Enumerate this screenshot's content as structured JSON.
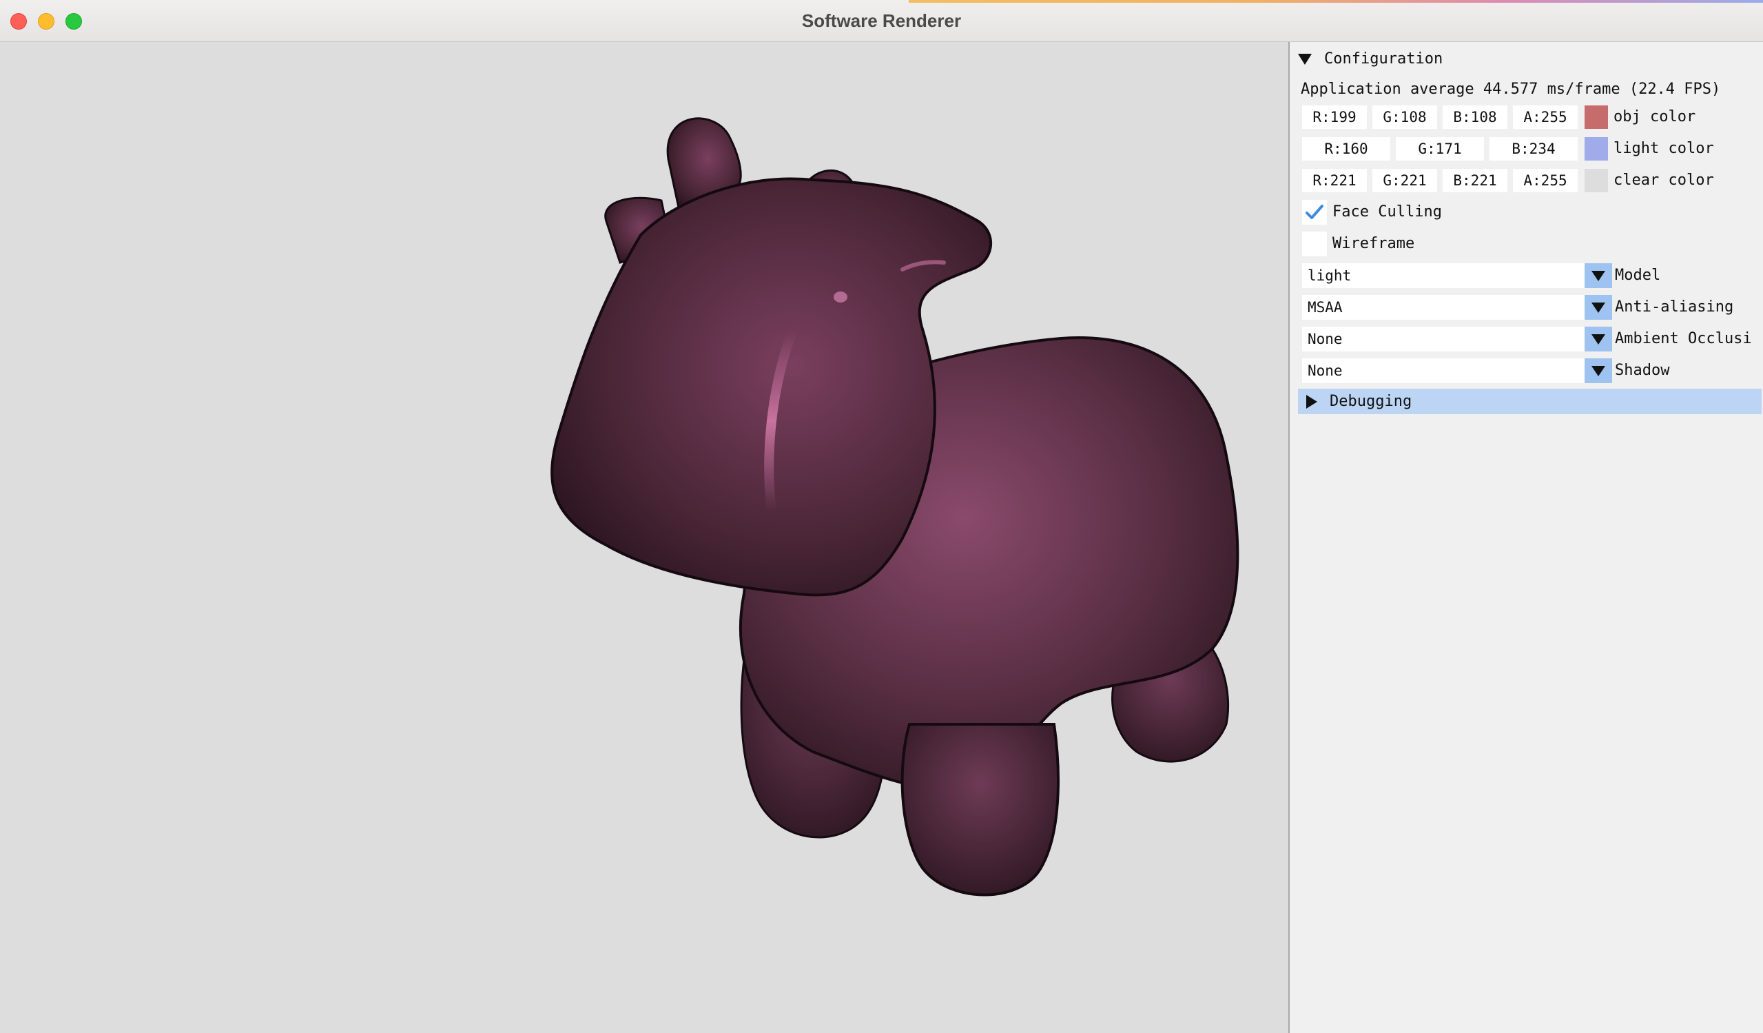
{
  "window": {
    "title": "Software Renderer"
  },
  "panel": {
    "header": "Configuration",
    "fps_text": "Application average 44.577 ms/frame (22.4 FPS)",
    "obj_color": {
      "r": "R:199",
      "g": "G:108",
      "b": "B:108",
      "a": "A:255",
      "label": "obj color",
      "swatch": "#c76c6c"
    },
    "light_color": {
      "r": "R:160",
      "g": "G:171",
      "b": "B:234",
      "label": "light color",
      "swatch": "#a0abea"
    },
    "clear_color": {
      "r": "R:221",
      "g": "G:221",
      "b": "B:221",
      "a": "A:255",
      "label": "clear color",
      "swatch": "#dddddd"
    },
    "face_culling": {
      "label": "Face Culling",
      "checked": true
    },
    "wireframe": {
      "label": "Wireframe",
      "checked": false
    },
    "model": {
      "value": "light",
      "label": "Model"
    },
    "anti_aliasing": {
      "value": "MSAA",
      "label": "Anti-aliasing"
    },
    "ambient_occlusion": {
      "value": "None",
      "label": "Ambient Occlusi"
    },
    "shadow": {
      "value": "None",
      "label": "Shadow"
    },
    "debugging": {
      "label": "Debugging"
    }
  },
  "viewport": {
    "clear_color": "#dddddd",
    "model_color": "#6b3a52",
    "model": "cow"
  }
}
